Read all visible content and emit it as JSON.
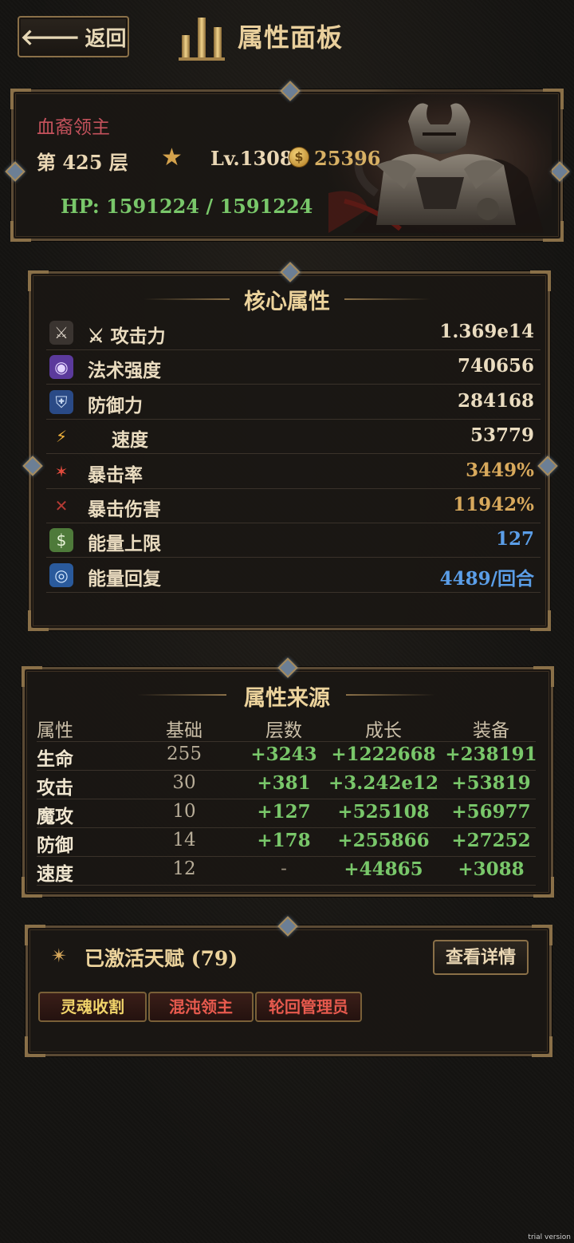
{
  "header": {
    "back_label": "返回",
    "title": "属性面板"
  },
  "character": {
    "name": "血裔领主",
    "floor": "第 425 层",
    "level": "Lv.1308",
    "gold": "25396",
    "hp": "HP: 1591224 / 1591224"
  },
  "core": {
    "title": "核心属性",
    "stats": [
      {
        "icon": "sword-icon",
        "label": "⚔ 攻击力",
        "value": "1.369e14",
        "color": "#eadcc0"
      },
      {
        "icon": "magic-orb-icon",
        "label": "法术强度",
        "value": "740656",
        "color": "#eadcc0"
      },
      {
        "icon": "shield-icon",
        "label": "防御力",
        "value": "284168",
        "color": "#eadcc0"
      },
      {
        "icon": "lightning-icon",
        "label": "速度",
        "value": "53779",
        "color": "#eadcc0"
      },
      {
        "icon": "crit-burst-icon",
        "label": "暴击率",
        "value": "3449%",
        "color": "#d8a95c"
      },
      {
        "icon": "crossed-swords-icon",
        "label": "暴击伤害",
        "value": "11942%",
        "color": "#d8a95c"
      },
      {
        "icon": "money-bag-icon",
        "label": "能量上限",
        "value": "127",
        "color": "#5b9ee8"
      },
      {
        "icon": "vortex-icon",
        "label": "能量回复",
        "value": "4489/回合",
        "color": "#5b9ee8"
      }
    ]
  },
  "source": {
    "title": "属性来源",
    "headers": [
      "属性",
      "基础",
      "层数",
      "成长",
      "装备"
    ],
    "rows": [
      [
        "生命",
        "255",
        "+3243",
        "+1222668",
        "+238191"
      ],
      [
        "攻击",
        "30",
        "+381",
        "+3.242e12",
        "+53819"
      ],
      [
        "魔攻",
        "10",
        "+127",
        "+525108",
        "+56977"
      ],
      [
        "防御",
        "14",
        "+178",
        "+255866",
        "+27252"
      ],
      [
        "速度",
        "12",
        "-",
        "+44865",
        "+3088"
      ]
    ]
  },
  "talents": {
    "title": "已激活天赋 (79)",
    "detail_label": "查看详情",
    "items": [
      {
        "label": "灵魂收割",
        "color": "#f0d36a"
      },
      {
        "label": "混沌领主",
        "color": "#e85a4e"
      },
      {
        "label": "轮回管理员",
        "color": "#e85a4e"
      }
    ]
  },
  "watermark": "trial version",
  "colors": {
    "gold": "#d7b064",
    "hp_green": "#79c76a",
    "name_red": "#c4525c",
    "green_value": "#79c76a",
    "blue_value": "#5b9ee8"
  }
}
